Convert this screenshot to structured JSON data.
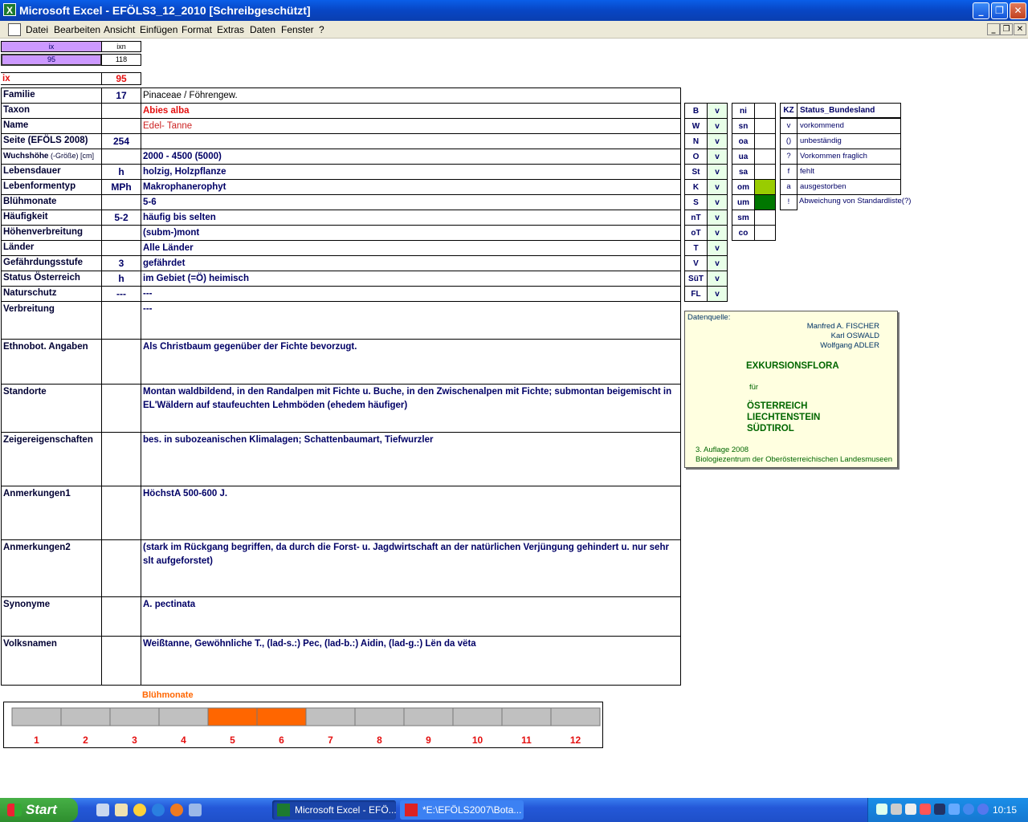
{
  "window": {
    "title": "Microsoft Excel - EFÖLS3_12_2010  [Schreibgeschützt]",
    "app_icon": "excel-icon",
    "controls": {
      "minimize": "_",
      "restore": "❐",
      "close": "✕"
    }
  },
  "menu": {
    "items": [
      "Datei",
      "Bearbeiten",
      "Ansicht",
      "Einfügen",
      "Format",
      "Extras",
      "Daten",
      "Fenster",
      "?"
    ],
    "doc_controls": {
      "minimize": "_",
      "restore": "❐",
      "close": "✕"
    }
  },
  "index_header": {
    "ix_label": "ix",
    "ixn_label": "ixn",
    "ix_value": "95",
    "ixn_value": "118"
  },
  "ix_row": {
    "label": "ix",
    "value": "95"
  },
  "fields": [
    {
      "label": "Familie",
      "code": "17",
      "value": "Pinaceae  /  Föhrengew."
    },
    {
      "label": "Taxon",
      "code": "",
      "value": "Abies alba"
    },
    {
      "label": "Name",
      "code": "",
      "value": "Edel- Tanne"
    },
    {
      "label": "Seite (EFÖLS 2008)",
      "code": "254",
      "value": ""
    },
    {
      "label": "Wuchshöhe",
      "label_suffix": " (-Größe) [cm]",
      "code": "",
      "value": " 2000 - 4500 (5000)"
    },
    {
      "label": "Lebensdauer",
      "code": "h",
      "value": "holzig, Holzpflanze"
    },
    {
      "label": "Lebenformentyp",
      "code": "MPh",
      "value": "Makrophanerophyt"
    },
    {
      "label": "Blühmonate",
      "code": "",
      "value": " 5-6"
    },
    {
      "label": "Häufigkeit",
      "code": "5-2",
      "value": "häufig bis selten"
    },
    {
      "label": "Höhenverbreitung",
      "code": "",
      "value": "(subm-)mont"
    },
    {
      "label": "Länder",
      "code": "",
      "value": "Alle Länder"
    },
    {
      "label": "Gefährdungsstufe",
      "code": "3",
      "value": "gefährdet"
    },
    {
      "label": "Status Österreich",
      "code": "h",
      "value": "im Gebiet (=Ö) heimisch"
    },
    {
      "label": "Naturschutz",
      "code": "---",
      "value": "---"
    }
  ],
  "text_fields": [
    {
      "label": "Verbreitung",
      "value": "---"
    },
    {
      "label": "Ethnobot. Angaben",
      "value": "Als Christbaum gegenüber der Fichte bevorzugt."
    },
    {
      "label": "Standorte",
      "value": "Montan waldbildend, in den Randalpen mit Fichte u. Buche, in den Zwischenalpen mit Fichte; submontan beigemischt in EL'Wäldern auf staufeuchten Lehmböden (ehedem häufiger)"
    },
    {
      "label": "Zeigereigenschaften",
      "value": "bes. in subozeanischen Klimalagen; Schattenbaumart, Tiefwurzler"
    },
    {
      "label": "Anmerkungen1",
      "value": "HöchstA 500-600 J."
    },
    {
      "label": "Anmerkungen2",
      "value": "(stark im Rückgang begriffen, da durch die Forst- u. Jagdwirtschaft an der natürlichen Verjüngung gehindert u. nur sehr slt aufgeforstet)"
    },
    {
      "label": "Synonyme",
      "value": "A. pectinata"
    },
    {
      "label": "Volksnamen",
      "value": "Weißtanne, Gewöhnliche T.,  (lad-s.:) Pec, (lad-b.:) Aidin, (lad-g.:) Lën da vëta"
    }
  ],
  "bundeslaender": [
    {
      "code": "B",
      "val": "v"
    },
    {
      "code": "W",
      "val": "v"
    },
    {
      "code": "N",
      "val": "v"
    },
    {
      "code": "O",
      "val": "v"
    },
    {
      "code": "St",
      "val": "v"
    },
    {
      "code": "K",
      "val": "v"
    },
    {
      "code": "S",
      "val": "v"
    },
    {
      "code": "nT",
      "val": "v"
    },
    {
      "code": "oT",
      "val": "v"
    },
    {
      "code": "T",
      "val": "v"
    },
    {
      "code": "V",
      "val": "v"
    },
    {
      "code": "SüT",
      "val": "v"
    },
    {
      "code": "FL",
      "val": "v"
    }
  ],
  "hoehenstufen": [
    {
      "code": "ni",
      "color": ""
    },
    {
      "code": "sn",
      "color": ""
    },
    {
      "code": "oa",
      "color": ""
    },
    {
      "code": "ua",
      "color": ""
    },
    {
      "code": "sa",
      "color": ""
    },
    {
      "code": "om",
      "color": "#99cc00"
    },
    {
      "code": "um",
      "color": "#007700"
    },
    {
      "code": "sm",
      "color": ""
    },
    {
      "code": "co",
      "color": ""
    }
  ],
  "status_legend": {
    "header_kz": "KZ",
    "header_status": "Status_Bundesland",
    "rows": [
      {
        "kz": "v",
        "text": "vorkommend"
      },
      {
        "kz": "()",
        "text": "unbeständig"
      },
      {
        "kz": "?",
        "text": "Vorkommen fraglich"
      },
      {
        "kz": "f",
        "text": "fehlt"
      },
      {
        "kz": "a",
        "text": "ausgestorben"
      },
      {
        "kz": "!",
        "text": "Abweichung von Standardliste(?)"
      }
    ]
  },
  "source_box": {
    "label": "Datenquelle:",
    "authors": [
      "Manfred A. FISCHER",
      "Karl OSWALD",
      "Wolfgang ADLER"
    ],
    "title": "EXKURSIONSFLORA",
    "fuer": "für",
    "regions": [
      "ÖSTERREICH",
      "LIECHTENSTEIN",
      "SÜDTIROL"
    ],
    "edition": "3. Auflage 2008",
    "publisher": "Biologiezentrum der Oberösterreichischen Landesmuseen"
  },
  "chart_data": {
    "type": "bar",
    "title": "Blühmonate",
    "categories": [
      "1",
      "2",
      "3",
      "4",
      "5",
      "6",
      "7",
      "8",
      "9",
      "10",
      "11",
      "12"
    ],
    "values": [
      0,
      0,
      0,
      0,
      1,
      1,
      0,
      0,
      0,
      0,
      0,
      0
    ],
    "active_color": "#ff6600",
    "inactive_color": "#c0c0c0"
  },
  "taskbar": {
    "start_label": "Start",
    "tasks": [
      {
        "label": "Microsoft Excel - EFÖ...",
        "icon": "excel-icon",
        "active": true
      },
      {
        "label": "*E:\\EFÖLS2007\\Bota...",
        "icon": "image-editor-icon",
        "active": false
      }
    ],
    "clock": "10:15"
  }
}
